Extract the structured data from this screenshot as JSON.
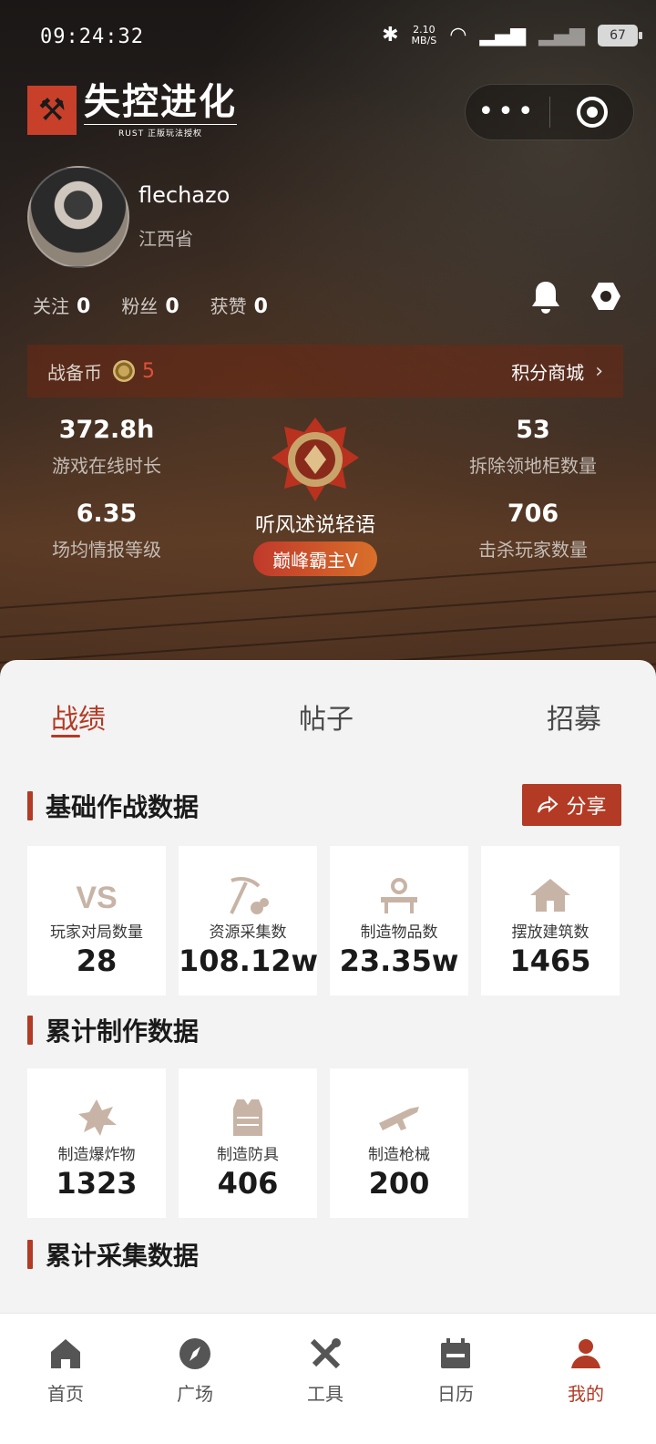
{
  "status_bar": {
    "time": "09:24:32",
    "net_speed_top": "2.10",
    "net_speed_bottom": "MB/S",
    "battery": "67"
  },
  "logo": {
    "title": "失控进化",
    "subtitle": "RUST 正版玩法授权"
  },
  "profile": {
    "username": "flechazo",
    "location": "江西省"
  },
  "counts": [
    {
      "label": "关注",
      "value": "0"
    },
    {
      "label": "粉丝",
      "value": "0"
    },
    {
      "label": "获赞",
      "value": "0"
    }
  ],
  "coin_bar": {
    "label": "战备币",
    "value": "5",
    "mall_label": "积分商城"
  },
  "stats": {
    "online_hours": {
      "value": "372.8h",
      "label": "游戏在线时长"
    },
    "intel_level": {
      "value": "6.35",
      "label": "场均情报等级"
    },
    "cabinets_destroyed": {
      "value": "53",
      "label": "拆除领地柜数量"
    },
    "kills": {
      "value": "706",
      "label": "击杀玩家数量"
    }
  },
  "rank": {
    "name": "听风述说轻语",
    "badge": "巅峰霸主V"
  },
  "tabs": [
    "战绩",
    "帖子",
    "招募"
  ],
  "sections": {
    "basic": {
      "title": "基础作战数据",
      "share_label": "分享",
      "tiles": [
        {
          "label": "玩家对局数量",
          "value": "28",
          "icon": "vs-icon"
        },
        {
          "label": "资源采集数",
          "value": "108.12w",
          "icon": "pickaxe-icon"
        },
        {
          "label": "制造物品数",
          "value": "23.35w",
          "icon": "workbench-icon"
        },
        {
          "label": "摆放建筑数",
          "value": "1465",
          "icon": "house-icon"
        }
      ]
    },
    "crafting": {
      "title": "累计制作数据",
      "tiles": [
        {
          "label": "制造爆炸物",
          "value": "1323",
          "icon": "explosive-icon"
        },
        {
          "label": "制造防具",
          "value": "406",
          "icon": "armor-icon"
        },
        {
          "label": "制造枪械",
          "value": "200",
          "icon": "rifle-icon"
        }
      ]
    },
    "gathering": {
      "title": "累计采集数据"
    }
  },
  "nav": [
    {
      "label": "首页",
      "icon": "home-icon"
    },
    {
      "label": "广场",
      "icon": "compass-icon"
    },
    {
      "label": "工具",
      "icon": "tools-icon"
    },
    {
      "label": "日历",
      "icon": "calendar-icon"
    },
    {
      "label": "我的",
      "icon": "user-icon"
    }
  ],
  "colors": {
    "accent": "#b33a24",
    "coin_value": "#e0503a"
  }
}
